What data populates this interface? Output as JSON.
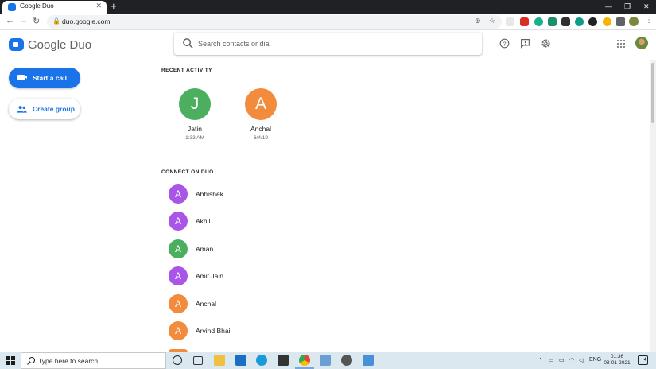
{
  "browser": {
    "tab_title": "Google Duo",
    "url": "duo.google.com"
  },
  "app": {
    "name": "Google Duo",
    "search_placeholder": "Search contacts or dial"
  },
  "actions": {
    "start_call": "Start a call",
    "create_group": "Create group"
  },
  "recent": {
    "heading": "RECENT ACTIVITY",
    "items": [
      {
        "initial": "J",
        "name": "Jatin",
        "time": "1:33 AM",
        "color": "#4caf60"
      },
      {
        "initial": "A",
        "name": "Anchal",
        "time": "6/4/19",
        "color": "#f28b3c"
      }
    ]
  },
  "connect": {
    "heading": "CONNECT ON DUO",
    "contacts": [
      {
        "initial": "A",
        "name": "Abhishek",
        "color": "#a855e8"
      },
      {
        "initial": "A",
        "name": "Akhil",
        "color": "#a855e8"
      },
      {
        "initial": "A",
        "name": "Aman",
        "color": "#4caf60"
      },
      {
        "initial": "A",
        "name": "Amit Jain",
        "color": "#a855e8"
      },
      {
        "initial": "A",
        "name": "Anchal",
        "color": "#f28b3c"
      },
      {
        "initial": "A",
        "name": "Arvind Bhai",
        "color": "#f28b3c"
      }
    ]
  },
  "taskbar": {
    "search_placeholder": "Type here to search",
    "language": "ENG",
    "time": "01:36",
    "date": "08-01-2021",
    "notification_count": "4"
  }
}
